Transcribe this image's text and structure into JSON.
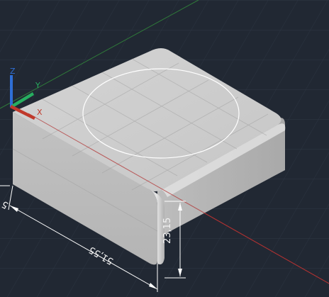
{
  "viewport": {
    "dimensions": {
      "width": "51,55",
      "height": "23,15",
      "side": "5"
    },
    "ucs": {
      "x_label": "X",
      "y_label": "Y",
      "z_label": "Z"
    },
    "colors": {
      "background": "#212833",
      "grid": "#2e3744",
      "x_axis": "#c0392b",
      "y_axis": "#27ae60",
      "z_axis": "#2f6fd6",
      "solid": "#c9c9c9",
      "dimension": "#ffffff"
    }
  }
}
